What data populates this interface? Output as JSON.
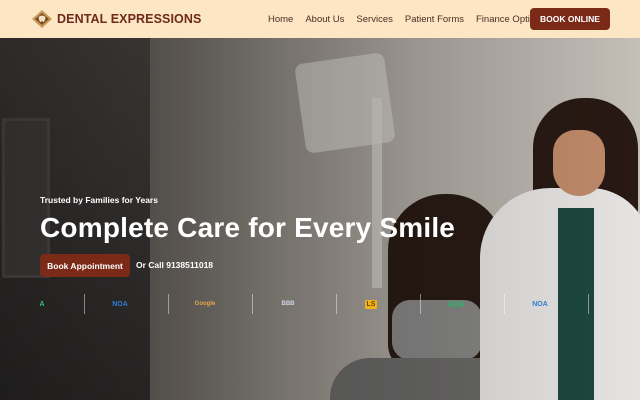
{
  "nav": {
    "brand": "DENTAL EXPRESSIONS",
    "menu": [
      {
        "label": "Home"
      },
      {
        "label": "About Us"
      },
      {
        "label": "Services"
      },
      {
        "label": "Patient Forms"
      },
      {
        "label": "Finance Options"
      }
    ],
    "book_label": "BOOK ONLINE"
  },
  "hero": {
    "tagline": "Trusted by Families for Years",
    "headline": "Complete Care for Every Smile",
    "appointment_label": "Book Appointment",
    "call_label": "Or Call 9138511018"
  },
  "badges": [
    {
      "text": "A",
      "icon": "aaid-logo-icon",
      "color": "#3fbf7a"
    },
    {
      "text": "NOA",
      "icon": "noa-logo-icon",
      "color": "#2d7fd1"
    },
    {
      "text": "Google",
      "icon": "google-reviews-icon",
      "color": "#e2a64a"
    },
    {
      "text": "BBB",
      "icon": "bbb-logo-icon",
      "color": "#cfd6e0"
    },
    {
      "text": "LS",
      "icon": "ls-logo-icon",
      "color": "#f0b21a"
    },
    {
      "text": "ADA",
      "icon": "ada-logo-icon",
      "color": "#2fb36b"
    },
    {
      "text": "NOA",
      "icon": "noa-logo-icon",
      "color": "#2d7fd1"
    }
  ],
  "colors": {
    "nav_bg": "#fde6c4",
    "brand_text": "#6e2a1a",
    "accent": "#7a2a17"
  }
}
